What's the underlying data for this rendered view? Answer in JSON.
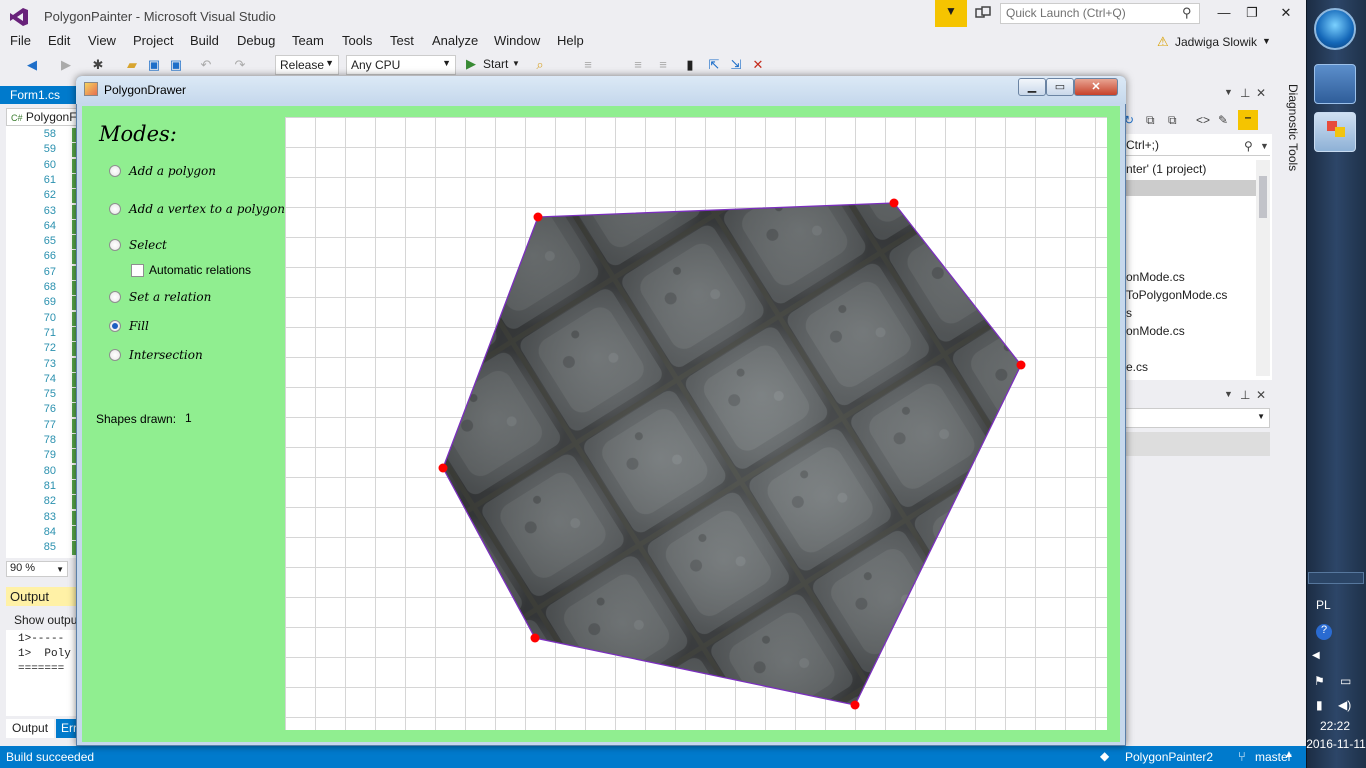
{
  "vs": {
    "title": "PolygonPainter - Microsoft Visual Studio",
    "quick_launch_placeholder": "Quick Launch (Ctrl+Q)",
    "menu": [
      "File",
      "Edit",
      "View",
      "Project",
      "Build",
      "Debug",
      "Team",
      "Tools",
      "Test",
      "Analyze",
      "Window",
      "Help"
    ],
    "user": "Jadwiga Slowik",
    "config": "Release",
    "platform": "Any CPU",
    "start_label": "Start"
  },
  "editor": {
    "tab": "Form1.cs",
    "nav_class": "PolygonF",
    "line_numbers": [
      "58",
      "59",
      "60",
      "61",
      "62",
      "63",
      "64",
      "65",
      "66",
      "67",
      "68",
      "69",
      "70",
      "71",
      "72",
      "73",
      "74",
      "75",
      "76",
      "77",
      "78",
      "79",
      "80",
      "81",
      "82",
      "83",
      "84",
      "85"
    ],
    "zoom": "90 %"
  },
  "output": {
    "header": "Output",
    "show_output_from": "Show outpu",
    "lines": [
      "1>-----",
      "1>  Poly",
      "======="
    ],
    "tab_output": "Output",
    "tab_errors": "Err"
  },
  "solution": {
    "search": "Ctrl+;)",
    "items": [
      "nter' (1 project)",
      "onMode.cs",
      "ToPolygonMode.cs",
      "s",
      "onMode.cs",
      "e.cs"
    ]
  },
  "diagnostic_tools_label": "Diagnostic Tools",
  "status": {
    "text": "Build succeeded",
    "repo": "PolygonPainter2",
    "branch": "master"
  },
  "taskbar": {
    "lang": "PL",
    "time": "22:22",
    "date": "2016-11-11"
  },
  "app": {
    "title": "PolygonDrawer",
    "modes_title": "Modes:",
    "modes": [
      {
        "label": "Add a polygon",
        "checked": false
      },
      {
        "label": "Add a vertex to a polygon",
        "checked": false
      },
      {
        "label": "Select",
        "checked": false
      },
      {
        "label": "Set a relation",
        "checked": false
      },
      {
        "label": "Fill",
        "checked": true
      },
      {
        "label": "Intersection",
        "checked": false
      }
    ],
    "automatic_relations_label": "Automatic relations",
    "automatic_relations_checked": false,
    "shapes_drawn_label": "Shapes drawn:",
    "shapes_drawn_value": "1",
    "colors": {
      "client_bg": "#90ee90",
      "vertex": "#ff0000",
      "edge": "#7b2fbe",
      "fill_texture": "stone-cobbles"
    }
  }
}
